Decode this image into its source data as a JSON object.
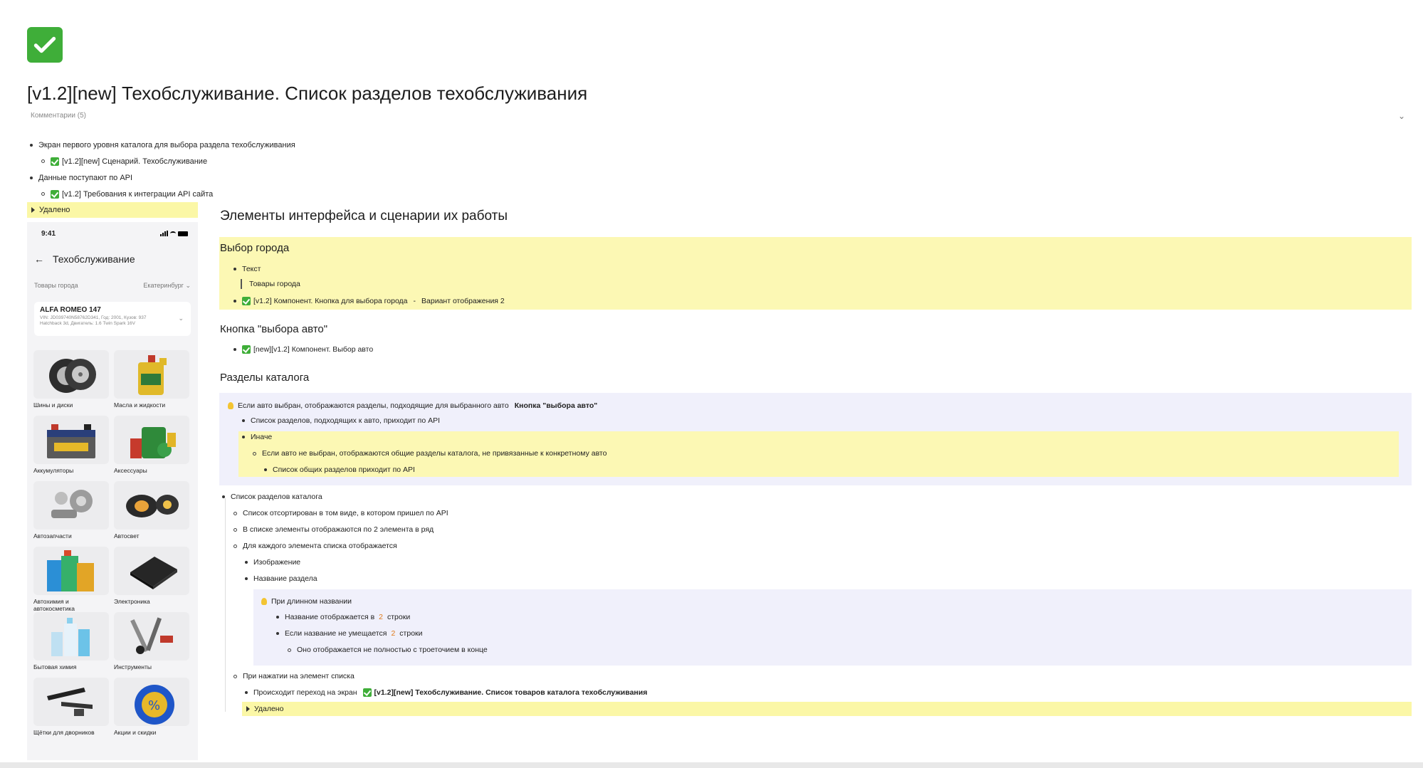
{
  "page": {
    "title": "[v1.2][new] Техобслуживание. Список разделов техобслуживания",
    "comments": "Комментарии (5)"
  },
  "top_list": [
    {
      "text": "Экран первого уровня каталога для выбора раздела техобслуживания",
      "level": 0
    },
    {
      "text": "[v1.2][new] Сценарий. Техобслуживание",
      "level": 1,
      "check": true
    },
    {
      "text": "Данные поступают по API",
      "level": 0
    },
    {
      "text": "[v1.2] Требования к интеграции API сайта",
      "level": 1,
      "check": true
    }
  ],
  "deleted_label": "Удалено",
  "phone": {
    "time": "9:41",
    "title": "Техобслуживание",
    "city_label": "Товары города",
    "city_value": "Екатеринбург",
    "car_name": "ALFA ROMEO 147",
    "car_vin_line1": "VIN: JD039740N58762D341, Год: 2001, Кузов: 937",
    "car_vin_line2": "Hatchback 3d, Двигатель: 1.6 Twin Spark 16V",
    "tiles": [
      {
        "label": "Шины и диски",
        "icon": "tire-icon"
      },
      {
        "label": "Масла и  жидкости",
        "icon": "oil-can-icon"
      },
      {
        "label": "Аккумуляторы",
        "icon": "battery-icon"
      },
      {
        "label": "Аксессуары",
        "icon": "accessories-icon"
      },
      {
        "label": "Автозапчасти",
        "icon": "parts-icon"
      },
      {
        "label": "Автосвет",
        "icon": "headlight-icon"
      },
      {
        "label": "Автохимия и автокосметика",
        "icon": "chemistry-icon"
      },
      {
        "label": "Электроника",
        "icon": "electronics-icon"
      },
      {
        "label": "Бытовая химия",
        "icon": "household-chemicals-icon"
      },
      {
        "label": "Инструменты",
        "icon": "tools-icon"
      },
      {
        "label": "Щётки для дворников",
        "icon": "wiper-icon"
      },
      {
        "label": "Акции и скидки",
        "icon": "discount-icon"
      }
    ]
  },
  "content": {
    "section_title": "Элементы интерфейса и сценарии их работы",
    "city_title": "Выбор города",
    "city_text_label": "Текст",
    "city_quote": "Товары города",
    "city_component": "[v1.2] Компонент. Кнопка для выбора города",
    "city_variant": "Вариант отображения 2",
    "car_title": "Кнопка \"выбора авто\"",
    "car_component": "[new][v1.2] Компонент. Выбор авто",
    "catalog_title": "Разделы каталога",
    "callout_text": "Если авто выбран, отображаются разделы, подходящие для выбранного авто",
    "callout_link": "Кнопка \"выбора авто\"",
    "callout_sub": "Список разделов, подходящих к авто, приходит по API",
    "else_label": "Иначе",
    "else_text": "Если авто не выбран, отображаются общие разделы каталога, не привязанные к конкретному авто",
    "else_sub": "Список общих разделов приходит по API",
    "list_title": "Список разделов каталога",
    "list_sorted": "Список отсортирован в том виде, в котором пришел по API",
    "list_two": "В списке элементы отображаются по 2 элемента в ряд",
    "list_each": "Для каждого элемента списка отображается",
    "list_image": "Изображение",
    "list_name": "Название раздела",
    "long_name": "При длинном названии",
    "shown_in": "Название отображается в",
    "lines_num": "2",
    "lines_word": "строки",
    "not_fit": "Если название не умещается",
    "ellipsis": "Оно отображается не полностью с троеточием в конце",
    "on_click": "При нажатии на элемент списка",
    "goes_to": "Происходит переход на экран",
    "goes_to_link": "[v1.2][new] Техобслуживание. Список товаров каталога техобслуживания",
    "deleted2": "Удалено"
  }
}
